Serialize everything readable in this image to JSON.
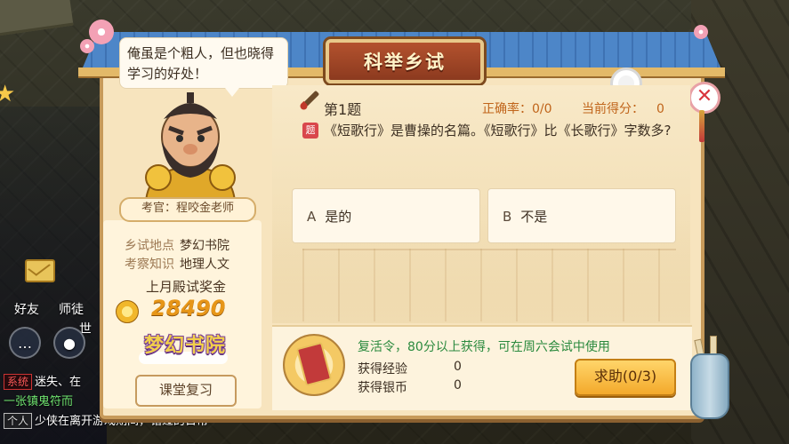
{
  "dialog": {
    "title": "科举乡试",
    "speech": "俺虽是个粗人，但也晓得学习的好处！",
    "examiner_label": "考官：程咬金老师",
    "info": [
      {
        "label": "乡试地点",
        "value": "梦幻书院"
      },
      {
        "label": "考察知识",
        "value": "地理人文"
      }
    ],
    "bonus_label": "上月殿试奖金",
    "bonus_value": "28490",
    "logo_text": "梦幻书院",
    "review_button": "课堂复习",
    "close_icon": "✕",
    "question": {
      "number": "第1题",
      "accuracy_label": "正确率：",
      "accuracy_value": "0/0",
      "score_label": "当前得分：",
      "score_value": "0",
      "text": "《短歌行》是曹操的名篇。《短歌行》比《长歌行》字数多?",
      "answers": [
        {
          "letter": "A",
          "text": "是的"
        },
        {
          "letter": "B",
          "text": "不是"
        }
      ]
    },
    "bottom": {
      "revive_text": "复活令，80分以上获得，可在周六会试中使用",
      "exp_label": "获得经验",
      "exp_value": "0",
      "silver_label": "获得银币",
      "silver_value": "0",
      "help_button": "求助(0/3)"
    }
  },
  "hud": {
    "friends": "好友",
    "mentor": "师徒",
    "world": "世",
    "chat": [
      {
        "tag": "系统",
        "text": "迷失、在"
      },
      {
        "tag": "",
        "text": "一张镇鬼符而"
      },
      {
        "tag": "个人",
        "text": "少侠在离开游戏期间，错过的日常"
      }
    ]
  },
  "colors": {
    "accent_orange": "#f3a92b",
    "title_red": "#8c3a1f",
    "roof_blue": "#4d86c8",
    "revive_green": "#2b8a3e"
  }
}
